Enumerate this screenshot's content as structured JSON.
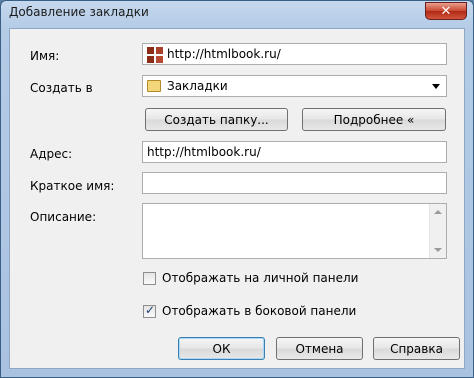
{
  "window": {
    "title": "Добавление закладки",
    "close_symbol": "✕"
  },
  "form": {
    "name_label": "Имя:",
    "name_value": "http://htmlbook.ru/",
    "create_in_label": "Создать в",
    "create_in_value": "Закладки",
    "new_folder_button": "Создать папку...",
    "details_button": "Подробнее «",
    "address_label": "Адрес:",
    "address_value": "http://htmlbook.ru/",
    "short_name_label": "Краткое имя:",
    "short_name_value": "",
    "description_label": "Описание:",
    "description_value": "",
    "show_personal_bar_label": "Отображать на личной панели",
    "show_personal_bar_checked": false,
    "show_sidebar_label": "Отображать в боковой панели",
    "show_sidebar_checked": true
  },
  "buttons": {
    "ok": "ОК",
    "cancel": "Отмена",
    "help": "Справка"
  }
}
